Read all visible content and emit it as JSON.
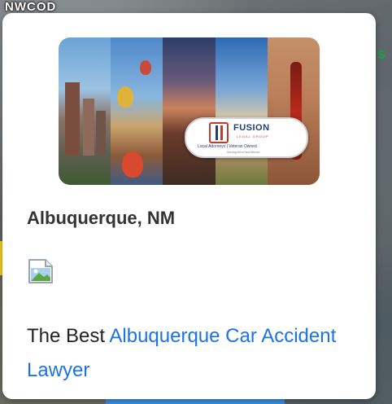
{
  "map": {
    "label": "NWCOD",
    "colors": {
      "green_mark": "#1da04a",
      "yellow": "#f2d21a",
      "blue": "#3d8fe0"
    }
  },
  "popup": {
    "banner": {
      "logo_name": "FUSION",
      "logo_sub": "LEGAL GROUP",
      "logo_tagline": "Local Attorneys  |  Veteran Owned",
      "logo_tagline2": "Serving All of New Mexico"
    },
    "title": "Albuquerque, NM",
    "broken_image_icon": "broken-image-icon",
    "description": {
      "prefix": "The Best ",
      "link_text": "Albuquerque Car Accident Lawyer",
      "link_color": "#1a73e8"
    }
  }
}
